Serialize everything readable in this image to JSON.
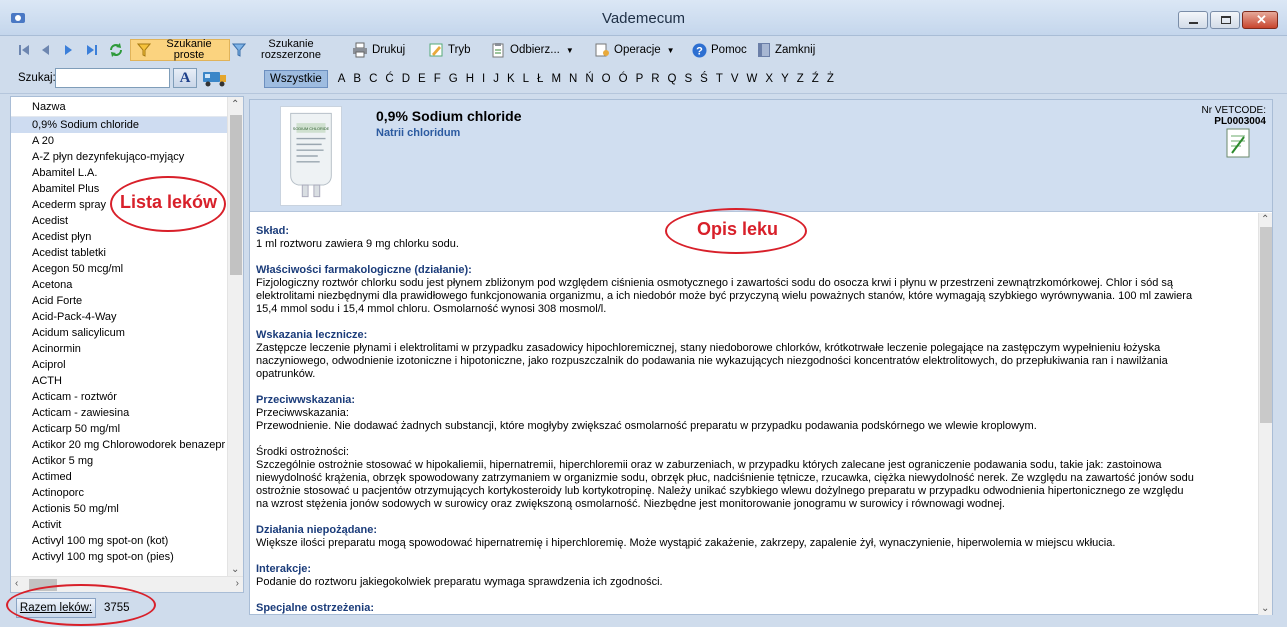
{
  "window": {
    "title": "Vademecum"
  },
  "toolbar": {
    "search_simple": "Szukanie proste",
    "search_advanced": "Szukanie rozszerzone",
    "print": "Drukuj",
    "mode": "Tryb",
    "recipients": "Odbierz...",
    "operations": "Operacje",
    "help": "Pomoc",
    "close": "Zamknij"
  },
  "search": {
    "label": "Szukaj:",
    "value": "",
    "font_button": "A"
  },
  "alphabet": {
    "all_label": "Wszystkie",
    "letters": [
      "A",
      "B",
      "C",
      "Ć",
      "D",
      "E",
      "F",
      "G",
      "H",
      "I",
      "J",
      "K",
      "L",
      "Ł",
      "M",
      "N",
      "Ń",
      "O",
      "Ó",
      "P",
      "R",
      "Q",
      "S",
      "Ś",
      "T",
      "V",
      "W",
      "X",
      "Y",
      "Z",
      "Ź",
      "Ż"
    ]
  },
  "list": {
    "header": "Nazwa",
    "items": [
      "0,9% Sodium chloride",
      "A 20",
      "A-Z płyn dezynfekująco-myjący",
      "Abamitel L.A.",
      "Abamitel Plus",
      "Acederm spray",
      "Acedist",
      "Acedist płyn",
      "Acedist tabletki",
      "Acegon 50 mcg/ml",
      "Acetona",
      "Acid Forte",
      "Acid-Pack-4-Way",
      "Acidum salicylicum",
      "Acinormin",
      "Aciprol",
      "ACTH",
      "Acticam - roztwór",
      "Acticam - zawiesina",
      "Acticarp 50 mg/ml",
      "Actikor 20 mg Chlorowodorek benazepr",
      "Actikor 5 mg",
      "Actimed",
      "Actinoporc",
      "Actionis 50 mg/ml",
      "Activit",
      "Activyl 100 mg spot-on (kot)",
      "Activyl 100 mg spot-on (pies)"
    ]
  },
  "counter": {
    "label": "Razem leków:",
    "value": "3755"
  },
  "detail": {
    "name": "0,9% Sodium chloride",
    "latin": "Natrii chloridum",
    "vet_label": "Nr VETCODE:",
    "vet_code": "PL0003004",
    "image_text": "SODIUM CHLORIDE",
    "sections": [
      {
        "title": "Skład:",
        "text": "1 ml roztworu zawiera 9 mg chlorku sodu."
      },
      {
        "title": "Właściwości farmakologiczne (działanie):",
        "text": "Fizjologiczny roztwór chlorku sodu jest płynem zbliżonym pod względem ciśnienia osmotycznego i zawartości sodu do osocza krwi i płynu w przestrzeni zewnątrzkomórkowej. Chlor i sód są\nelektrolitami niezbędnymi dla prawidłowego funkcjonowania organizmu, a ich niedobór może być przyczyną wielu poważnych stanów, które wymagają szybkiego wyrównywania. 100 ml zawiera\n15,4 mmol sodu i 15,4 mmol chloru. Osmolarność wynosi 308 mosmol/l."
      },
      {
        "title": "Wskazania lecznicze:",
        "text": "Zastępcze leczenie płynami i elektrolitami w przypadku zasadowicy hipochloremicznej, stany niedoborowe chlorków, krótkotrwałe leczenie polegające na zastępczym wypełnieniu łożyska\nnaczyniowego, odwodnienie izotoniczne i hipotoniczne, jako rozpuszczalnik do podawania nie wykazujących niezgodności koncentratów elektrolitowych, do przepłukiwania ran i nawilżania\nopatrunków."
      },
      {
        "title": "Przeciwwskazania:",
        "text": "Przeciwwskazania:\nPrzewodnienie. Nie dodawać żadnych substancji, które mogłyby zwiększać osmolarność preparatu w przypadku podawania podskórnego we wlewie kroplowym."
      },
      {
        "title": "",
        "text": "Środki ostrożności:\nSzczególnie ostrożnie stosować w hipokaliemii, hipernatremii, hiperchloremii oraz w zaburzeniach, w przypadku których zalecane jest ograniczenie podawania sodu, takie jak: zastoinowa\nniewydolność krążenia, obrzęk spowodowany zatrzymaniem w organizmie sodu, obrzęk płuc, nadciśnienie tętnicze, rzucawka, ciężka niewydolność nerek. Ze względu na zawartość jonów sodu\nostrożnie stosować u pacjentów otrzymujących kortykosteroidy lub kortykotropinę. Należy unikać szybkiego wlewu dożylnego preparatu w przypadku odwodnienia hipertonicznego ze względu\nna wzrost stężenia jonów sodowych w surowicy oraz zwiększoną osmolarność. Niezbędne jest monitorowanie jonogramu w surowicy i równowagi wodnej."
      },
      {
        "title": "Działania niepożądane:",
        "text": "Większe ilości preparatu mogą spowodować hipernatremię i hiperchloremię. Może wystąpić zakażenie, zakrzepy, zapalenie żył, wynaczynienie, hiperwolemia w miejscu wkłucia."
      },
      {
        "title": "Interakcje:",
        "text": "Podanie do roztworu jakiegokolwiek preparatu wymaga sprawdzenia ich zgodności."
      },
      {
        "title": "Specjalne ostrzeżenia:",
        "text": ""
      }
    ]
  },
  "annotations": {
    "list": "Lista leków",
    "detail": "Opis leku"
  }
}
